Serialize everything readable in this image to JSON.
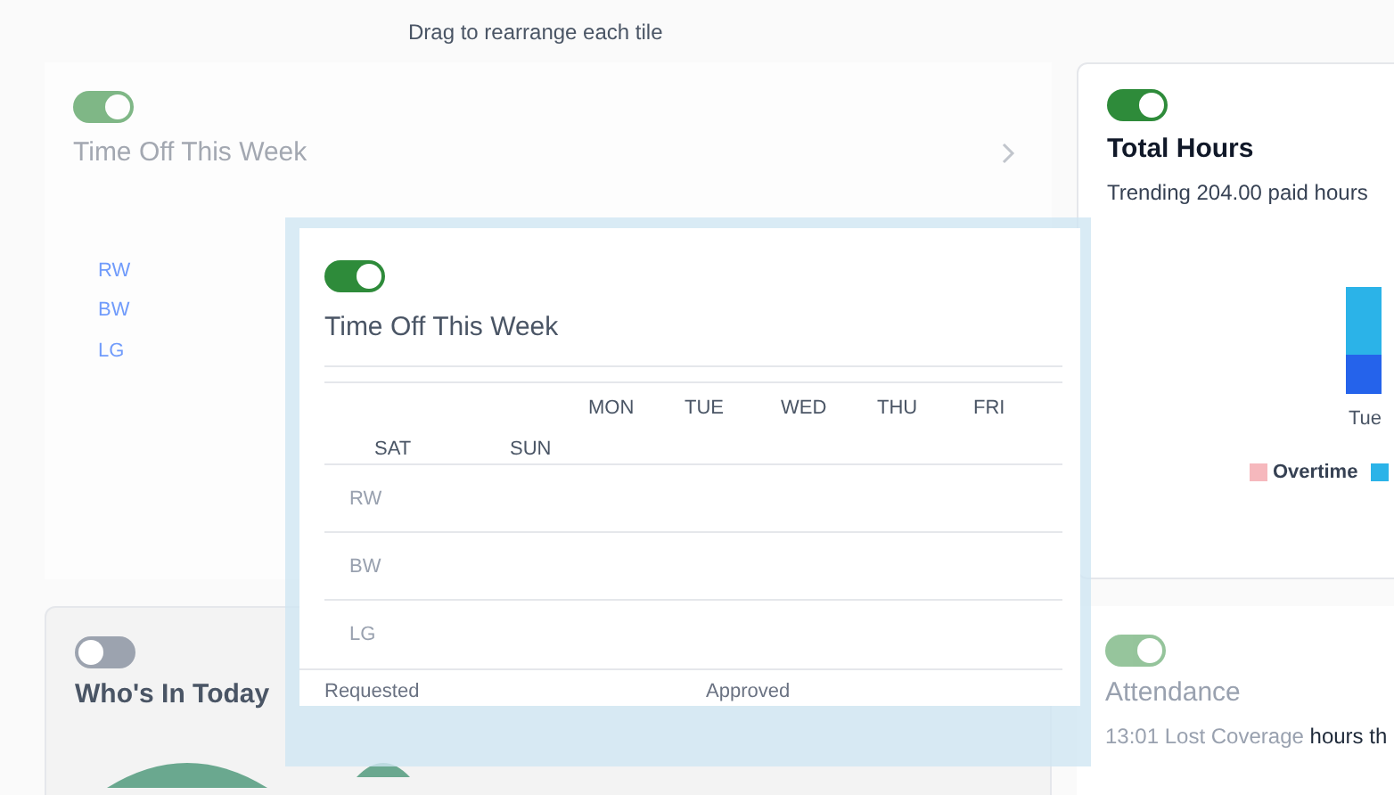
{
  "hint": "Drag to rearrange each tile",
  "tiles": [
    {
      "kind": "time_off",
      "title": "Time Off This Week",
      "on": true,
      "rows": [
        "RW",
        "BW",
        "LG"
      ]
    },
    {
      "kind": "total_hours",
      "title": "Total Hours",
      "on": true,
      "subtitle": "Trending 204.00 paid hours",
      "axis_label": "Tue",
      "legend": "Overtime"
    },
    {
      "kind": "who",
      "title": "Who's In Today",
      "on": false
    },
    {
      "kind": "attendance",
      "title": "Attendance",
      "on": true,
      "subtitle_faded": "13:01 Lost Coverage",
      "subtitle": "hours th"
    }
  ],
  "dragged": {
    "title": "Time Off This Week",
    "on": true,
    "columns_top": [
      "MON",
      "TUE",
      "WED",
      "THU",
      "FRI"
    ],
    "columns_bottom": [
      "SAT",
      "SUN"
    ],
    "rows": [
      "RW",
      "BW",
      "LG"
    ],
    "footer": [
      "Requested",
      "Approved"
    ]
  }
}
